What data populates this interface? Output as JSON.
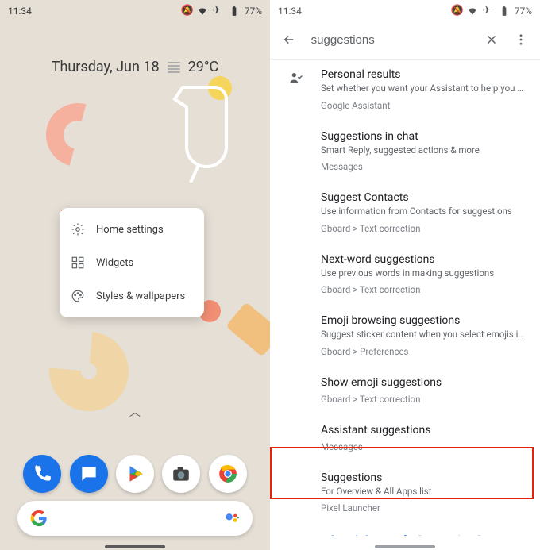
{
  "status": {
    "time": "11:34",
    "battery_pct": "77%",
    "icons": [
      "dnd",
      "wifi",
      "airplane",
      "battery"
    ]
  },
  "home": {
    "date": "Thursday, Jun 18",
    "temp": "29°C",
    "caret": "︿",
    "menu": {
      "home_settings": "Home settings",
      "widgets": "Widgets",
      "styles": "Styles & wallpapers"
    },
    "dock": [
      "Phone",
      "Messages",
      "Play Store",
      "Camera",
      "Chrome"
    ]
  },
  "settings": {
    "query": "suggestions",
    "results": [
      {
        "title": "Personal results",
        "desc": "Set whether you want your Assistant to help you with y...",
        "path": "Google Assistant",
        "icon": true
      },
      {
        "title": "Suggestions in chat",
        "desc": "Smart Reply, suggested actions & more",
        "path": "Messages"
      },
      {
        "title": "Suggest Contacts",
        "desc": "Use information from Contacts for suggestions",
        "path": "Gboard > Text correction"
      },
      {
        "title": "Next-word suggestions",
        "desc": "Use previous words in making suggestions",
        "path": "Gboard > Text correction"
      },
      {
        "title": "Emoji browsing suggestions",
        "desc": "Suggest sticker content when you select emojis in the...",
        "path": "Gboard > Preferences"
      },
      {
        "title": "Show emoji suggestions",
        "desc": "",
        "path": "Gboard > Text correction"
      },
      {
        "title": "Assistant suggestions",
        "desc": "",
        "path": "Messages"
      },
      {
        "title": "Suggestions",
        "desc": "For Overview & All Apps list",
        "path": "Pixel Launcher"
      }
    ],
    "support_link": "Search Support for \"suggestions\""
  }
}
